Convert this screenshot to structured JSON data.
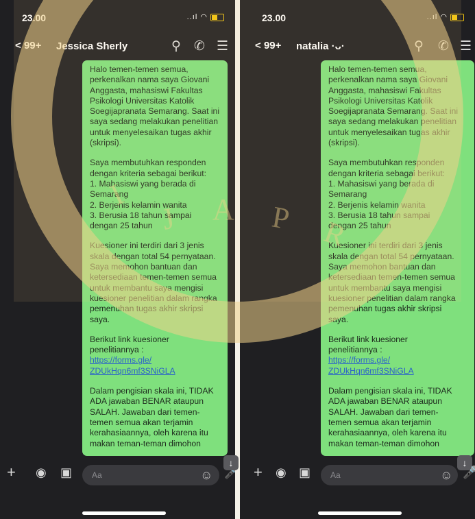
{
  "left": {
    "time": "23.00",
    "signal": "..ıl",
    "back_count": "99+",
    "contact": "Jessica Sherly",
    "input_placeholder": "Aa",
    "message": {
      "p1": "Halo temen-temen semua,\nperkenalkan nama saya Giovani\nAnggasta, mahasiswi Fakultas\nPsikologi Universitas Katolik\nSoegijapranata Semarang. Saat ini\nsaya sedang melakukan penelitian\nuntuk menyelesaikan tugas akhir\n(skripsi).",
      "p2": "Saya membutuhkan responden\ndengan kriteria sebagai berikut:\n1. Mahasiswi yang berada di\nSemarang\n2. Berjenis kelamin wanita\n3. Berusia 18 tahun sampai\ndengan 25 tahun",
      "p3": "Kuesioner ini terdiri dari 3 jenis\nskala dengan total 54 pernyataan.\nSaya memohon bantuan dan\nketersediaan temen-temen semua\nuntuk membantu saya mengisi\nkuesioner penelitian dalam rangka\npemenuhan tugas akhir skripsi\nsaya.",
      "p4": "Berikut link kuesioner\npenelitiannya :",
      "link": "https://forms.gle/\nZDUkHqn6mf3SNiGLA",
      "p5": "Dalam pengisian skala ini, TIDAK\nADA jawaban BENAR ataupun\nSALAH. Jawaban dari temen-\ntemen semua akan terjamin\nkerahasiaannya, oleh karena itu\nmakan teman-teman dimohon"
    }
  },
  "right": {
    "time": "23.00",
    "signal": "..ıl",
    "back_count": "99+",
    "contact": "natalia ·ᴗ·",
    "input_placeholder": "Aa",
    "message": {
      "p1": "Halo temen-temen semua,\nperkenalkan nama saya Giovani\nAnggasta, mahasiswi Fakultas\nPsikologi Universitas Katolik\nSoegijapranata Semarang. Saat ini\nsaya sedang melakukan penelitian\nuntuk menyelesaikan tugas akhir\n(skripsi).",
      "p2": "Saya membutuhkan responden\ndengan kriteria sebagai berikut:\n1. Mahasiswi yang berada di\nSemarang\n2. Berjenis kelamin wanita\n3. Berusia 18 tahun sampai\ndengan 25 tahun",
      "p3": "Kuesioner ini terdiri dari 3 jenis\nskala dengan total 54 pernyataan.\nSaya memohon bantuan dan\nketersediaan temen-temen semua\nuntuk membantu saya mengisi\nkuesioner penelitian dalam rangka\npemenuhan tugas akhir skripsi\nsaya.",
      "p4": "Berikut link kuesioner\npenelitiannya :",
      "link": "https://forms.gle/\nZDUkHqn6mf3SNiGLA",
      "p5": "Dalam pengisian skala ini, TIDAK\nADA jawaban BENAR ataupun\nSALAH. Jawaban dari temen-\ntemen semua akan terjamin\nkerahasiaannya, oleh karena itu\nmakan teman-teman dimohon"
    }
  },
  "icons": {
    "search": "search-icon",
    "call": "phone-icon",
    "menu": "menu-icon",
    "add": "plus-icon",
    "camera": "camera-icon",
    "gallery": "image-icon",
    "emoji": "emoji-icon",
    "mic": "mic-icon",
    "scroll_down": "arrow-down-icon"
  },
  "colors": {
    "chat_bg": "#1f1f22",
    "bubble": "#7fe07d",
    "link": "#2b62c9",
    "watermark": "#f1d28a"
  },
  "watermark_text": "SOEGIJAPRANATA"
}
